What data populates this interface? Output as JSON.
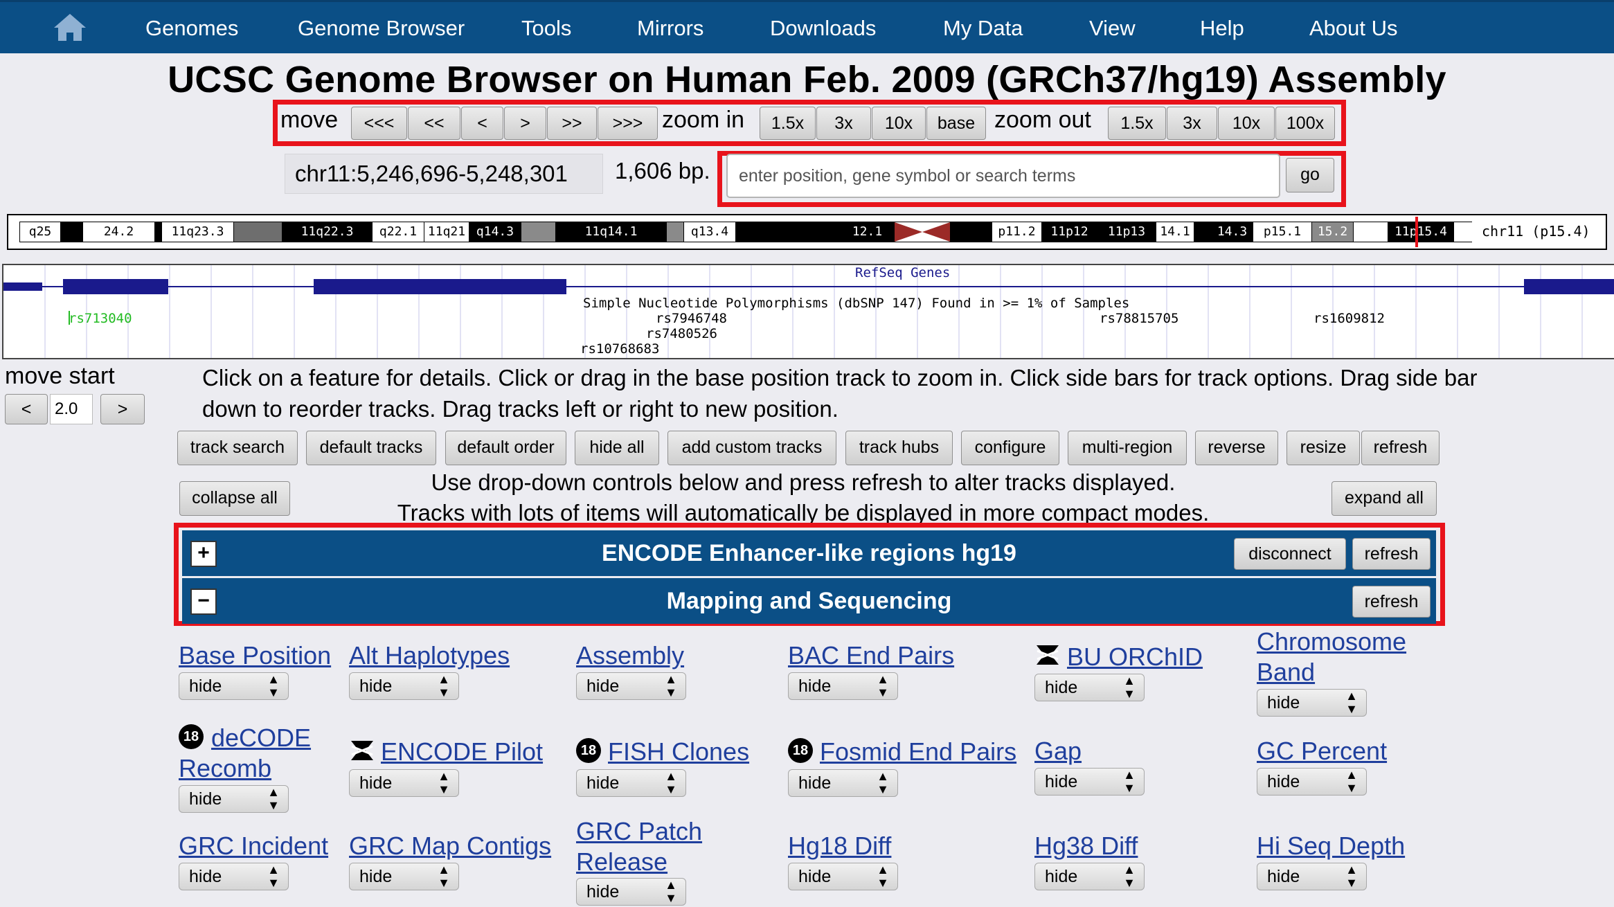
{
  "nav": {
    "items": [
      "Genomes",
      "Genome Browser",
      "Tools",
      "Mirrors",
      "Downloads",
      "My Data",
      "View",
      "Help",
      "About Us"
    ]
  },
  "page_title": "UCSC Genome Browser on Human Feb. 2009 (GRCh37/hg19) Assembly",
  "move": {
    "label": "move",
    "buttons": [
      "<<<",
      "<<",
      "<",
      ">",
      ">>",
      ">>>"
    ]
  },
  "zoom_in": {
    "label": "zoom in",
    "buttons": [
      "1.5x",
      "3x",
      "10x",
      "base"
    ]
  },
  "zoom_out": {
    "label": "zoom out",
    "buttons": [
      "1.5x",
      "3x",
      "10x",
      "100x"
    ]
  },
  "position": {
    "value": "chr11:5,246,696-5,248,301",
    "size": "1,606 bp.",
    "search_placeholder": "enter position, gene symbol or search terms",
    "go_label": "go"
  },
  "ideogram": {
    "bands": [
      "q25",
      "24.2",
      "11q23.3",
      "11q22.3",
      "q22.1",
      "11q21",
      "q14.3",
      "11q14.1",
      "q13.4",
      "12.1",
      "p11.2",
      "11p12",
      "11p13",
      "14.1",
      "14.3",
      "p15.1",
      "15.2",
      "11p15.4"
    ],
    "chrom_label": "chr11 (p15.4)"
  },
  "tracks_image": {
    "refseq_label": "RefSeq Genes",
    "snp_label": "Simple Nucleotide Polymorphisms (dbSNP 147) Found in >= 1% of Samples",
    "snps": [
      "rs713040",
      "rs7946748",
      "rs7480526",
      "rs10768683",
      "rs78815705",
      "rs1609812"
    ]
  },
  "move_start": {
    "label": "move start",
    "left": "<",
    "value": "2.0",
    "right": ">"
  },
  "instructions": {
    "line1": "Click on a feature for details. Click or drag in the base position track to zoom in. Click side bars for track options. Drag side bar",
    "line2": "down to reorder tracks. Drag tracks left or right to new position."
  },
  "controls": [
    "track search",
    "default tracks",
    "default order",
    "hide all",
    "add custom tracks",
    "track hubs",
    "configure",
    "multi-region",
    "reverse",
    "resize",
    "refresh"
  ],
  "collapse_all": "collapse all",
  "expand_all": "expand all",
  "drop_instructions": {
    "line1": "Use drop-down controls below and press refresh to alter tracks displayed.",
    "line2": "Tracks with lots of items will automatically be displayed in more compact modes."
  },
  "groups": [
    {
      "toggle": "+",
      "title": "ENCODE Enhancer-like regions hg19",
      "disconnect": "disconnect",
      "refresh": "refresh"
    },
    {
      "toggle": "−",
      "title": "Mapping and Sequencing",
      "refresh": "refresh"
    }
  ],
  "track_visibility_default": "hide",
  "tracks": [
    {
      "name": "Base Position",
      "visibility": "hide"
    },
    {
      "name": "Alt Haplotypes",
      "visibility": "hide"
    },
    {
      "name": "Assembly",
      "visibility": "hide"
    },
    {
      "name": "BAC End Pairs",
      "visibility": "hide"
    },
    {
      "name": "BU ORChID",
      "visibility": "hide",
      "icon": "archived-icon"
    },
    {
      "name_line1": "Chromosome",
      "name_line2": "Band",
      "visibility": "hide"
    },
    {
      "name_line1": "deCODE",
      "name_line2": "Recomb",
      "visibility": "hide",
      "badge": "18"
    },
    {
      "name": "ENCODE Pilot",
      "visibility": "hide",
      "icon": "archived-icon"
    },
    {
      "name": "FISH Clones",
      "visibility": "hide",
      "badge": "18"
    },
    {
      "name": "Fosmid End Pairs",
      "visibility": "hide",
      "badge": "18"
    },
    {
      "name": "Gap",
      "visibility": "hide"
    },
    {
      "name": "GC Percent",
      "visibility": "hide"
    },
    {
      "name": "GRC Incident",
      "visibility": "hide"
    },
    {
      "name": "GRC Map Contigs",
      "visibility": "hide"
    },
    {
      "name_line1": "GRC Patch",
      "name_line2": "Release",
      "visibility": "hide"
    },
    {
      "name": "Hg18 Diff",
      "visibility": "hide"
    },
    {
      "name": "Hg38 Diff",
      "visibility": "hide"
    },
    {
      "name": "Hi Seq Depth",
      "visibility": "hide"
    }
  ],
  "colors": {
    "nav_bg": "#0b4f86",
    "highlight_red": "#e8131b",
    "link_blue": "#1f3f9d",
    "refseq_blue": "#1a1a8c",
    "snp_green": "#22bb22"
  }
}
